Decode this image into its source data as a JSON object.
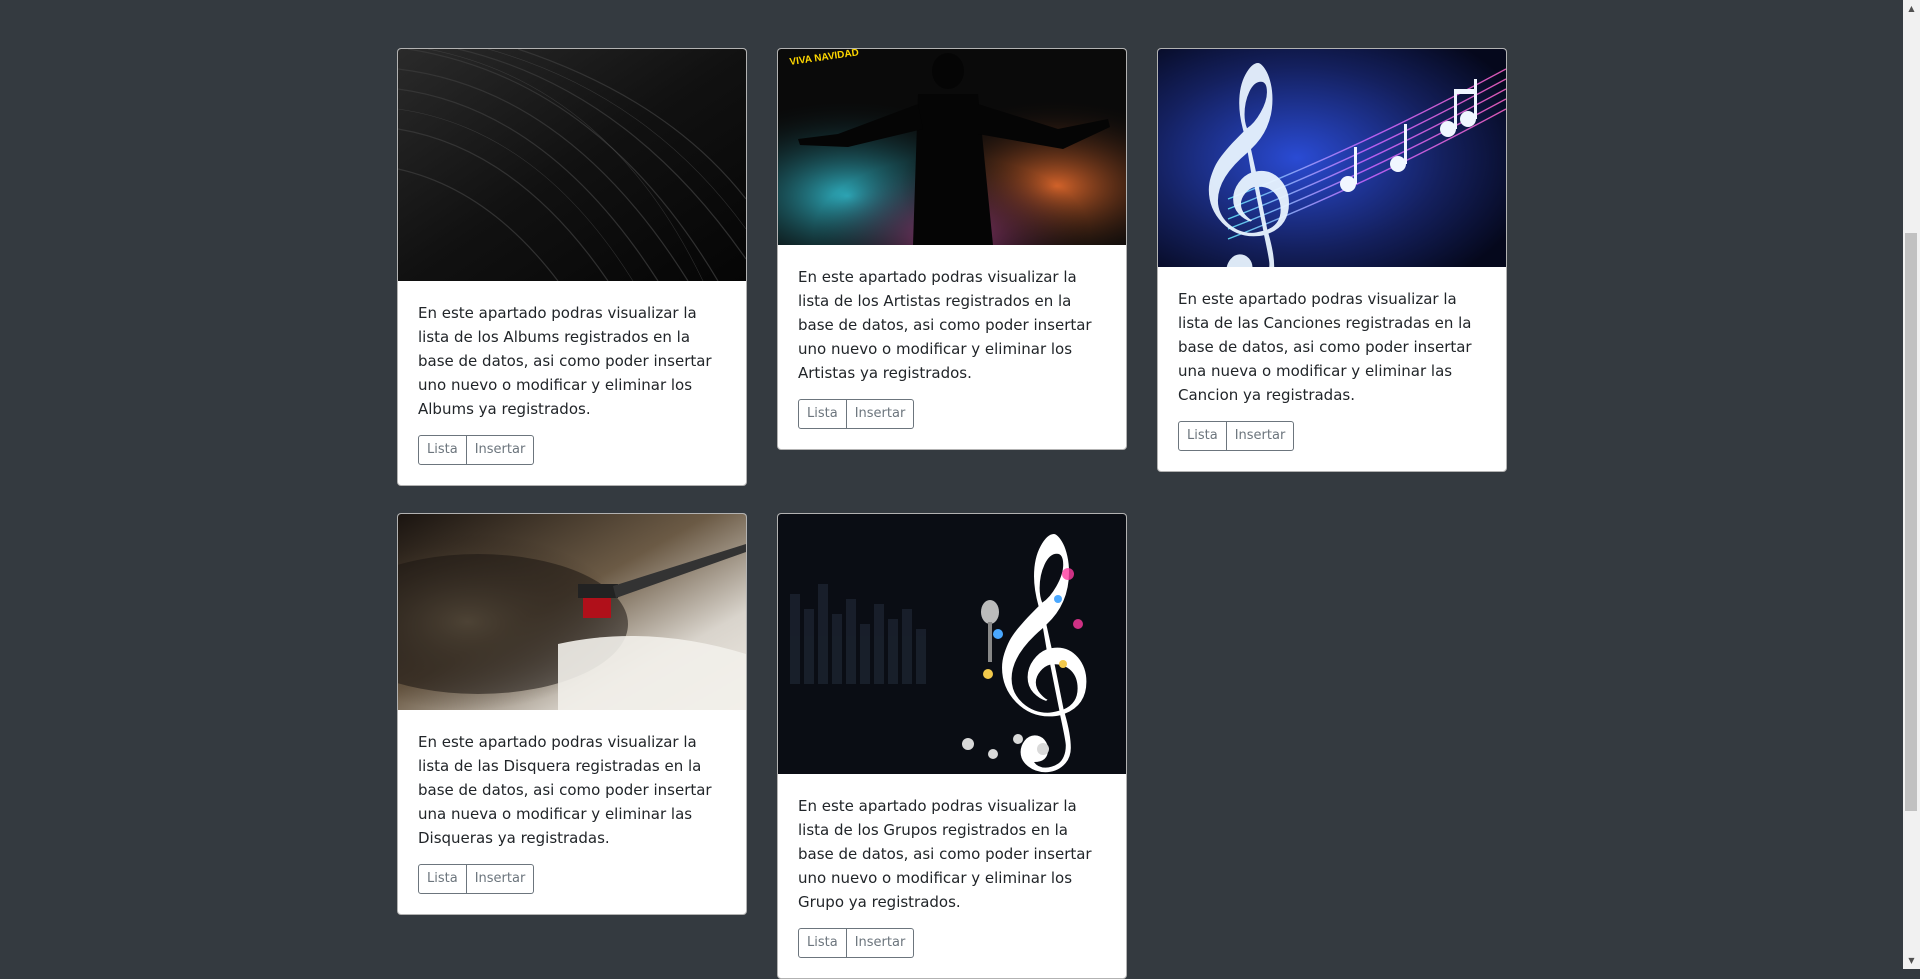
{
  "cards": [
    {
      "text": "En este apartado podras visualizar la lista de los Albums registrados en la base de datos, asi como poder insertar uno nuevo o modificar y eliminar los Albums ya registrados.",
      "list_label": "Lista",
      "insert_label": "Insertar"
    },
    {
      "text": "En este apartado podras visualizar la lista de los Artistas registrados en la base de datos, asi como poder insertar uno nuevo o modificar y eliminar los Artistas ya registrados.",
      "list_label": "Lista",
      "insert_label": "Insertar"
    },
    {
      "text": "En este apartado podras visualizar la lista de las Canciones registradas en la base de datos, asi como poder insertar una nueva o modificar y eliminar las Cancion ya registradas.",
      "list_label": "Lista",
      "insert_label": "Insertar"
    },
    {
      "text": "En este apartado podras visualizar la lista de las Disquera registradas en la base de datos, asi como poder insertar una nueva o modificar y eliminar las Disqueras ya registradas.",
      "list_label": "Lista",
      "insert_label": "Insertar"
    },
    {
      "text": "En este apartado podras visualizar la lista de los Grupos registrados en la base de datos, asi como poder insertar uno nuevo o modificar y eliminar los Grupo ya registrados.",
      "list_label": "Lista",
      "insert_label": "Insertar"
    }
  ],
  "images": {
    "albums": "vinyl-record-grooves",
    "artistas": "singer-silhouette",
    "artistas_logo": "VIVA NAVIDAD",
    "canciones": "neon-treble-clef",
    "disquera": "turntable",
    "grupos": "treble-clef-microphone"
  },
  "colors": {
    "page_bg": "#343a40",
    "card_bg": "#ffffff",
    "button_outline": "#6c757d"
  }
}
